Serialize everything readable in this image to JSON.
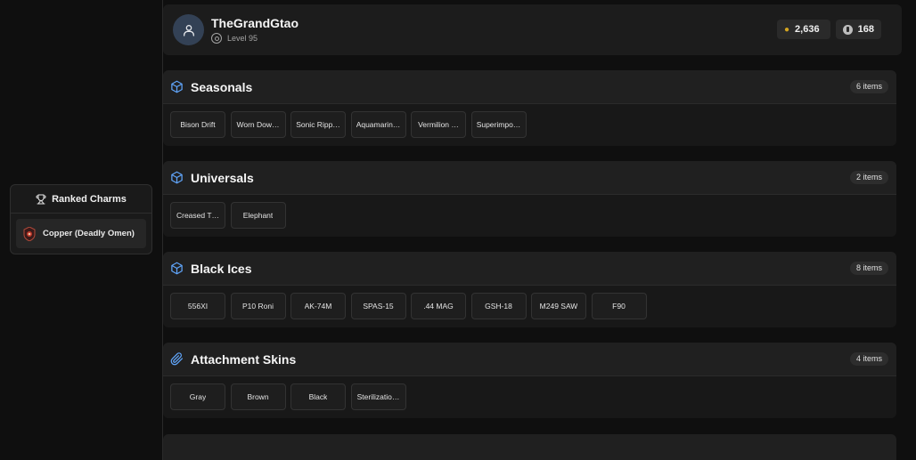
{
  "profile": {
    "username": "TheGrandGtao",
    "level": "Level 95",
    "credits": "2,636",
    "coins": "168"
  },
  "ranked_charms": {
    "title": "Ranked Charms",
    "item": "Copper (Deadly Omen)"
  },
  "sections": [
    {
      "title": "Seasonals",
      "count": "6 items",
      "icon": "cube-icon",
      "items": [
        "Bison Drift",
        "Worn Dow…",
        "Sonic Ripp…",
        "Aquamarin…",
        "Vermilion …",
        "Superimpo…"
      ]
    },
    {
      "title": "Universals",
      "count": "2 items",
      "icon": "cube-icon",
      "items": [
        "Creased T…",
        "Elephant"
      ]
    },
    {
      "title": "Black Ices",
      "count": "8 items",
      "icon": "cube-icon",
      "items": [
        "556XI",
        "P10 Roni",
        "AK-74M",
        "SPAS-15",
        ".44 MAG",
        "GSH-18",
        "M249 SAW",
        "F90"
      ]
    },
    {
      "title": "Attachment Skins",
      "count": "4 items",
      "icon": "paperclip-icon",
      "items": [
        "Gray",
        "Brown",
        "Black",
        "Sterilizatio…"
      ]
    }
  ],
  "colors": {
    "accent": "#60a5fa",
    "avatar_bg": "#334155",
    "gold": "#d4a520"
  }
}
